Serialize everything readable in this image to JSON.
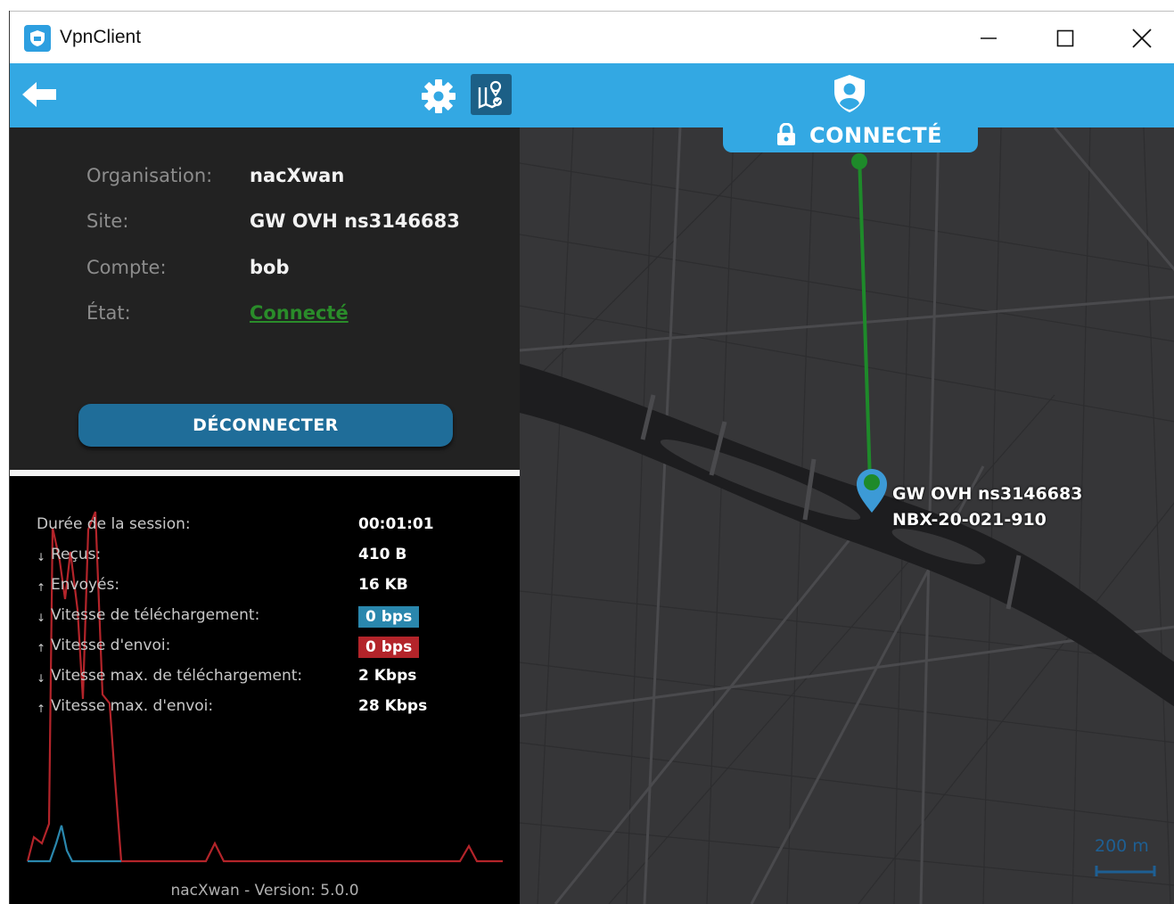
{
  "window": {
    "title": "VpnClient"
  },
  "toolbar": {
    "status": "CONNECTÉ"
  },
  "info": {
    "rows": [
      {
        "label": "Organisation:",
        "value": "nacXwan"
      },
      {
        "label": "Site:",
        "value": "GW OVH ns3146683"
      },
      {
        "label": "Compte:",
        "value": "bob"
      },
      {
        "label": "État:",
        "value": "Connecté"
      }
    ],
    "disconnect_label": "DÉCONNECTER"
  },
  "stats": {
    "rows": [
      {
        "arrow": "",
        "label": "Durée de la session:",
        "value": "00:01:01"
      },
      {
        "arrow": "↓",
        "label": "Reçus:",
        "value": "410 B"
      },
      {
        "arrow": "↑",
        "label": "Envoyés:",
        "value": "16 KB"
      },
      {
        "arrow": "↓",
        "label": "Vitesse de téléchargement:",
        "value": "0 bps"
      },
      {
        "arrow": "↑",
        "label": "Vitesse d'envoi:",
        "value": "0 bps"
      },
      {
        "arrow": "↓",
        "label": "Vitesse max. de téléchargement:",
        "value": "2 Kbps"
      },
      {
        "arrow": "↑",
        "label": "Vitesse max. d'envoi:",
        "value": "28 Kbps"
      }
    ],
    "version": "nacXwan - Version: 5.0.0"
  },
  "map": {
    "marker_line1": "GW OVH ns3146683",
    "marker_line2": "NBX-20-021-910",
    "scale": "200 m"
  },
  "colors": {
    "accent": "#33a8e3",
    "connected_green": "#2a8c2a",
    "download_blue": "#2a87ad",
    "upload_red": "#b3242a",
    "map_route": "#1e8a2a"
  },
  "icons": {
    "app": "shield-icon",
    "back": "arrow-left-icon",
    "settings": "gear-icon",
    "map_toggle": "map-location-icon",
    "status": "shield-user-icon",
    "lock": "lock-icon",
    "marker": "map-pin-icon"
  }
}
